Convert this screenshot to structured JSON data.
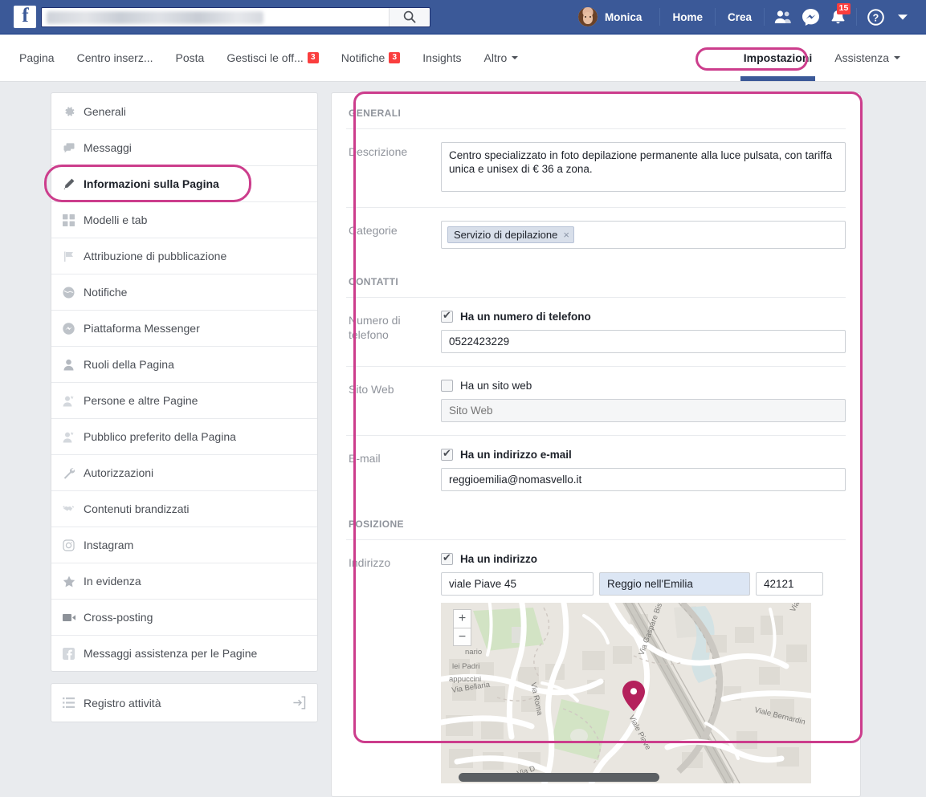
{
  "topbar": {
    "logo": "f",
    "search": {
      "value": "",
      "placeholder": "",
      "icon": "search-icon",
      "redacted": true
    },
    "account_name": "Monica",
    "home_label": "Home",
    "create_label": "Crea",
    "icons": [
      "friends-icon",
      "messenger-icon",
      "notifications-bell-icon",
      "help-icon",
      "account-chevron-down-icon"
    ],
    "notification_badge": "15",
    "bg_color": "#3b5998"
  },
  "tabs": {
    "items": [
      {
        "label": "Pagina",
        "badge": ""
      },
      {
        "label": "Centro inserz...",
        "badge": ""
      },
      {
        "label": "Posta",
        "badge": ""
      },
      {
        "label": "Gestisci le off...",
        "badge": "3"
      },
      {
        "label": "Notifiche",
        "badge": "3"
      },
      {
        "label": "Insights",
        "badge": ""
      },
      {
        "label": "Altro",
        "badge": "",
        "caret": true
      }
    ],
    "settings_label": "Impostazioni",
    "support_label": "Assistenza",
    "active": "Impostazioni",
    "annotation_color": "#cc3d8c"
  },
  "sidebar": {
    "items": [
      {
        "label": "Generali",
        "icon": "gear-icon"
      },
      {
        "label": "Messaggi",
        "icon": "messages-icon"
      },
      {
        "label": "Informazioni sulla Pagina",
        "icon": "pencil-icon",
        "active": true
      },
      {
        "label": "Modelli e tab",
        "icon": "grid-icon"
      },
      {
        "label": "Attribuzione di pubblicazione",
        "icon": "flag-icon"
      },
      {
        "label": "Notifiche",
        "icon": "globe-icon"
      },
      {
        "label": "Piattaforma Messenger",
        "icon": "messenger-icon"
      },
      {
        "label": "Ruoli della Pagina",
        "icon": "person-icon"
      },
      {
        "label": "Persone e altre Pagine",
        "icon": "person-star-icon"
      },
      {
        "label": "Pubblico preferito della Pagina",
        "icon": "person-star-icon"
      },
      {
        "label": "Autorizzazioni",
        "icon": "wrench-icon"
      },
      {
        "label": "Contenuti brandizzati",
        "icon": "handshake-icon"
      },
      {
        "label": "Instagram",
        "icon": "instagram-icon"
      },
      {
        "label": "In evidenza",
        "icon": "star-icon"
      },
      {
        "label": "Cross-posting",
        "icon": "video-camera-icon"
      },
      {
        "label": "Messaggi assistenza per le Pagine",
        "icon": "facebook-square-icon"
      }
    ],
    "activity_log": {
      "label": "Registro attività",
      "icon": "list-icon",
      "trailing_icon": "external-link-icon"
    }
  },
  "main": {
    "section_generali": "GENERALI",
    "section_contatti": "CONTATTI",
    "section_posizione": "POSIZIONE",
    "descrizione": {
      "label": "Descrizione",
      "value": "Centro specializzato in foto depilazione permanente alla luce pulsata, con tariffa unica e unisex di € 36 a zona."
    },
    "categorie": {
      "label": "Categorie",
      "tokens": [
        {
          "text": "Servizio di depilazione",
          "remove_icon": "×"
        }
      ]
    },
    "telefono": {
      "label": "Numero di telefono",
      "checkbox_label": "Ha un numero di telefono",
      "checked": true,
      "value": "0522423229"
    },
    "sito_web": {
      "label": "Sito Web",
      "checkbox_label": "Ha un sito web",
      "checked": false,
      "value": "",
      "placeholder": "Sito Web"
    },
    "email": {
      "label": "E-mail",
      "checkbox_label": "Ha un indirizzo e-mail",
      "checked": true,
      "value": "reggioemilia@nomasvello.it"
    },
    "indirizzo": {
      "label": "Indirizzo",
      "checkbox_label": "Ha un indirizzo",
      "checked": true,
      "street": "viale Piave 45",
      "city": "Reggio nell'Emilia",
      "zip": "42121"
    },
    "map": {
      "zoom_in": "+",
      "zoom_out": "−",
      "pin_icon": "map-pin-icon",
      "labels": [
        "Via Gaspare Bis",
        "Via Roma",
        "Via Bellaria",
        "Viale Piave",
        "Viale Bernardin",
        "Via",
        "nario",
        "lei Padri",
        "appuccini",
        "Via D"
      ]
    },
    "annotation_color": "#cc3d8c"
  }
}
